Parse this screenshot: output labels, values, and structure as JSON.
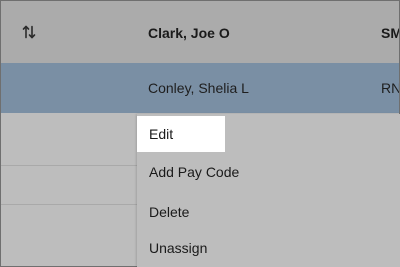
{
  "table": {
    "header": {
      "sort_icon": "swap-vertical-icon",
      "name": "Clark, Joe O",
      "role": "SM"
    },
    "selected_row": {
      "name": "Conley, Shelia L",
      "role": "RN"
    }
  },
  "context_menu": {
    "items": [
      {
        "label": "Edit",
        "highlighted": true
      },
      {
        "label": "Add Pay Code",
        "highlighted": false
      },
      {
        "label": "Delete",
        "highlighted": false
      },
      {
        "label": "Unassign",
        "highlighted": false
      }
    ]
  },
  "colors": {
    "header_bg": "#ababab",
    "selected_row_bg": "#7a8fa4",
    "menu_bg": "#bdbdbd",
    "highlight_bg": "#ffffff"
  }
}
